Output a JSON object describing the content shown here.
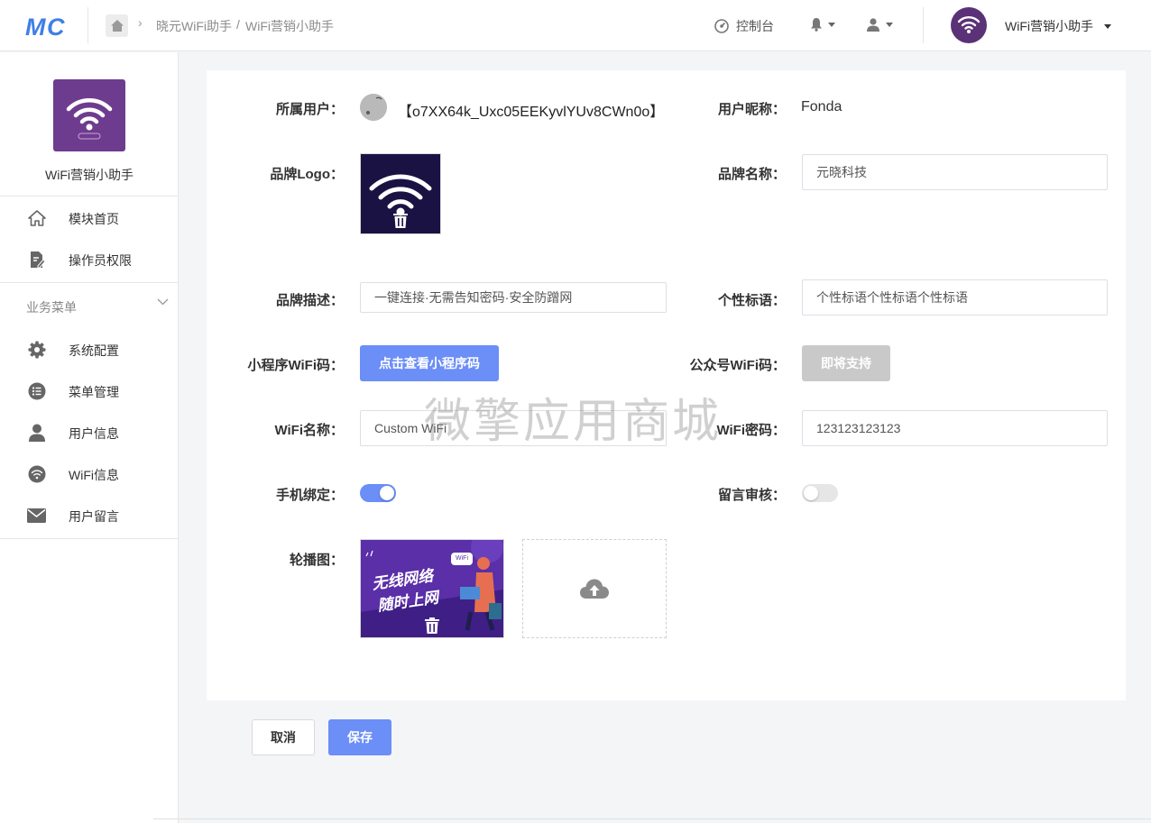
{
  "colors": {
    "primary": "#6b8ef7",
    "disabled": "#c9c9c9",
    "brand_purple": "#6e3c8e"
  },
  "header": {
    "logo_icon": "mc-logo-icon",
    "breadcrumb": [
      "晓元WiFi助手",
      "WiFi营销小助手"
    ],
    "breadcrumb_sep": "/",
    "console": "控制台",
    "account_name": "WiFi营销小助手"
  },
  "sidebar": {
    "app_name": "WiFi营销小助手",
    "top_items": [
      {
        "label": "模块首页",
        "icon": "home-icon"
      },
      {
        "label": "操作员权限",
        "icon": "edit-document-icon"
      }
    ],
    "group_title": "业务菜单",
    "group_items": [
      {
        "label": "系统配置",
        "icon": "gear-icon"
      },
      {
        "label": "菜单管理",
        "icon": "list-icon"
      },
      {
        "label": "用户信息",
        "icon": "user-icon"
      },
      {
        "label": "WiFi信息",
        "icon": "wifi-circle-icon"
      },
      {
        "label": "用户留言",
        "icon": "mail-icon"
      }
    ]
  },
  "form": {
    "owner_label": "所属用户：",
    "owner_value": "【o7XX64k_Uxc05EEKyvlYUv8CWn0o】",
    "nickname_label": "用户昵称：",
    "nickname_value": "Fonda",
    "brand_logo_label": "品牌Logo：",
    "brand_name_label": "品牌名称：",
    "brand_name_value": "元晓科技",
    "brand_desc_label": "品牌描述：",
    "brand_desc_value": "一键连接·无需告知密码·安全防蹭网",
    "slogan_label": "个性标语：",
    "slogan_value": "个性标语个性标语个性标语",
    "mini_wifi_label": "小程序WiFi码：",
    "mini_wifi_button": "点击查看小程序码",
    "mp_wifi_label": "公众号WiFi码：",
    "mp_wifi_button": "即将支持",
    "wifi_name_label": "WiFi名称：",
    "wifi_name_value": "Custom WiFi",
    "wifi_pwd_label": "WiFi密码：",
    "wifi_pwd_value": "123123123123",
    "phone_bind_label": "手机绑定：",
    "phone_bind_on": true,
    "msg_review_label": "留言审核：",
    "msg_review_on": false,
    "carousel_label": "轮播图：",
    "banner_line1": "无线网络",
    "banner_line2": "随时上网",
    "banner_badge": "WiFi"
  },
  "actions": {
    "cancel": "取消",
    "save": "保存"
  },
  "watermark": "微擎应用商城"
}
